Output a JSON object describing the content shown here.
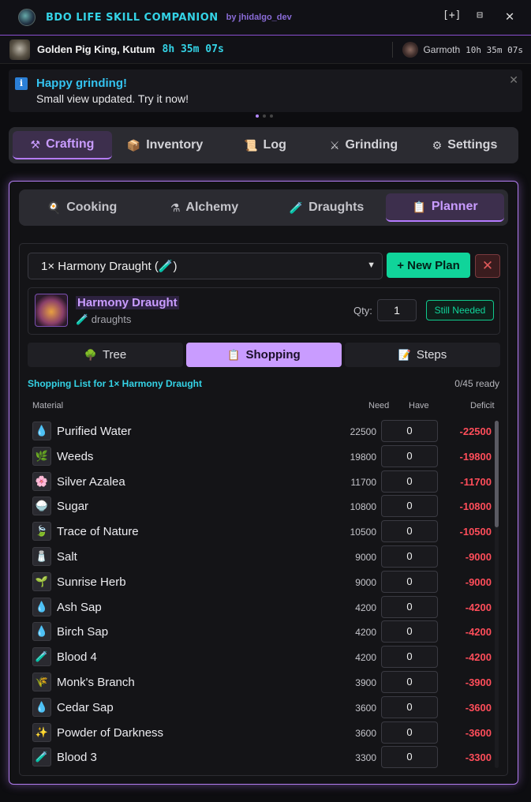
{
  "titlebar": {
    "app_title": "BDO LIFE SKILL COMPANION",
    "by": "by jhidalgo_dev",
    "pin": "[+]",
    "minimize": "⊟",
    "close": "✕"
  },
  "bossbar": {
    "boss_name": "Golden Pig King, Kutum",
    "boss_timer": "8h 35m 07s",
    "next_boss_name": "Garmoth",
    "next_boss_timer": "10h 35m 07s"
  },
  "notice": {
    "icon": "info-icon",
    "title": "Happy grinding!",
    "body": "Small view updated. Try it now!",
    "close": "✕"
  },
  "main_tabs": [
    {
      "label": "Crafting",
      "icon": "⚒",
      "active": true
    },
    {
      "label": "Inventory",
      "icon": "📦",
      "active": false
    },
    {
      "label": "Log",
      "icon": "📜",
      "active": false
    },
    {
      "label": "Grinding",
      "icon": "⚔",
      "active": false
    },
    {
      "label": "Settings",
      "icon": "⚙",
      "active": false
    }
  ],
  "sub_tabs": [
    {
      "label": "Cooking",
      "icon": "🍳",
      "active": false
    },
    {
      "label": "Alchemy",
      "icon": "⚗",
      "active": false
    },
    {
      "label": "Draughts",
      "icon": "🧪",
      "active": false
    },
    {
      "label": "Planner",
      "icon": "📋",
      "active": true
    }
  ],
  "planner": {
    "selected_plan": "1× Harmony Draught (🧪)",
    "new_plan": "+ New Plan",
    "delete": "✕",
    "item_name": "Harmony Draught",
    "item_category": "🧪 draughts",
    "qty_label": "Qty:",
    "qty_value": "1",
    "status_badge": "Still Needed",
    "view_tabs": [
      {
        "label": "Tree",
        "icon": "🌳",
        "active": false
      },
      {
        "label": "Shopping",
        "icon": "📋",
        "active": true
      },
      {
        "label": "Steps",
        "icon": "📝",
        "active": false
      }
    ],
    "shopping_title": "Shopping List for 1× Harmony Draught",
    "ready": "0/45 ready",
    "columns": {
      "material": "Material",
      "need": "Need",
      "have": "Have",
      "deficit": "Deficit"
    },
    "rows": [
      {
        "icon": "💧",
        "name": "Purified Water",
        "need": "22500",
        "have": "0",
        "deficit": "-22500"
      },
      {
        "icon": "🌿",
        "name": "Weeds",
        "need": "19800",
        "have": "0",
        "deficit": "-19800"
      },
      {
        "icon": "🌸",
        "name": "Silver Azalea",
        "need": "11700",
        "have": "0",
        "deficit": "-11700"
      },
      {
        "icon": "🍚",
        "name": "Sugar",
        "need": "10800",
        "have": "0",
        "deficit": "-10800"
      },
      {
        "icon": "🍃",
        "name": "Trace of Nature",
        "need": "10500",
        "have": "0",
        "deficit": "-10500"
      },
      {
        "icon": "🧂",
        "name": "Salt",
        "need": "9000",
        "have": "0",
        "deficit": "-9000"
      },
      {
        "icon": "🌱",
        "name": "Sunrise Herb",
        "need": "9000",
        "have": "0",
        "deficit": "-9000"
      },
      {
        "icon": "💧",
        "name": "Ash Sap",
        "need": "4200",
        "have": "0",
        "deficit": "-4200"
      },
      {
        "icon": "💧",
        "name": "Birch Sap",
        "need": "4200",
        "have": "0",
        "deficit": "-4200"
      },
      {
        "icon": "🧪",
        "name": "Blood 4",
        "need": "4200",
        "have": "0",
        "deficit": "-4200"
      },
      {
        "icon": "🌾",
        "name": "Monk's Branch",
        "need": "3900",
        "have": "0",
        "deficit": "-3900"
      },
      {
        "icon": "💧",
        "name": "Cedar Sap",
        "need": "3600",
        "have": "0",
        "deficit": "-3600"
      },
      {
        "icon": "✨",
        "name": "Powder of Darkness",
        "need": "3600",
        "have": "0",
        "deficit": "-3600"
      },
      {
        "icon": "🧪",
        "name": "Blood 3",
        "need": "3300",
        "have": "0",
        "deficit": "-3300"
      }
    ]
  },
  "colors": {
    "accent_purple": "#c99cff",
    "accent_cyan": "#34d3e6",
    "accent_green": "#10d49a",
    "deficit_red": "#ff4d5a"
  }
}
